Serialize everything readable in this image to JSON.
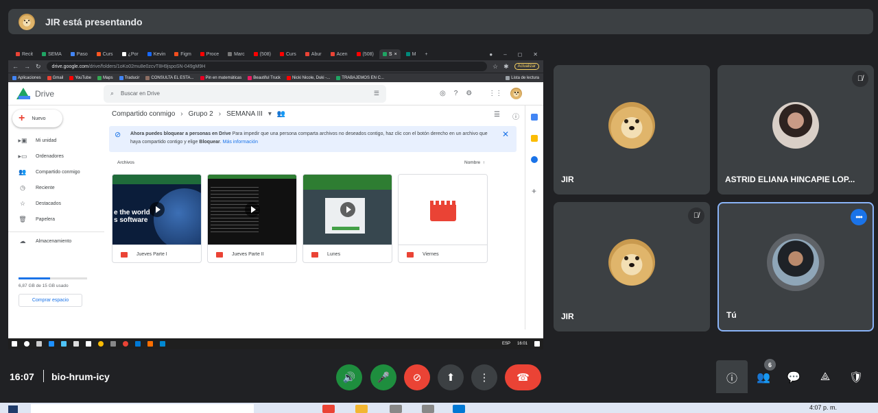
{
  "banner": {
    "text": "JIR está presentando",
    "avatar": "doge-avatar"
  },
  "shared_screen": {
    "browser": {
      "tabs": [
        "Recit",
        "SEMA",
        "Paso",
        "Curs",
        "¿Por",
        "Kevin",
        "Figm",
        "Proce",
        "Marc",
        "(508)",
        "Curs",
        "Abur",
        "Acen",
        "(508)",
        "S",
        "M"
      ],
      "url_domain": "drive.google.com",
      "url_path": "/drive/folders/1oKo02mu8e0zcvT8H9jspoSN-049gM9H",
      "update_label": "Actualizar",
      "bookmarks": [
        "Aplicaciones",
        "Gmail",
        "YouTube",
        "Maps",
        "Traducir",
        "CONSULTA EL ESTA...",
        "Pin en matemáticas",
        "Beautiful Truck",
        "Nicki Nicole, Duki -...",
        "TRABAJEMOS EN C..."
      ],
      "reading_list": "Lista de lectura"
    },
    "drive": {
      "app_name": "Drive",
      "search_placeholder": "Buscar en Drive",
      "new_label": "Nuevo",
      "nav": [
        "Mi unidad",
        "Ordenadores",
        "Compartido conmigo",
        "Reciente",
        "Destacados",
        "Papelera",
        "Almacenamiento"
      ],
      "storage_text": "6,87 GB de 15 GB usado",
      "storage_fraction": 0.458,
      "buy_label": "Comprar espacio",
      "breadcrumb": [
        "Compartido conmigo",
        "Grupo 2",
        "SEMANA III"
      ],
      "notice_bold": "Ahora puedes bloquear a personas en Drive",
      "notice_text": " Para impedir que una persona comparta archivos no deseados contigo, haz clic con el botón derecho en un archivo que haya compartido contigo y elige ",
      "notice_bold2": "Bloquear",
      "notice_link": "Más información",
      "section_label": "Archivos",
      "sort_label": "Nombre",
      "files": [
        {
          "name": "Jueves Parte I",
          "thumb_text": "e the world\ns software"
        },
        {
          "name": "Jueves Parte II"
        },
        {
          "name": "Lunes"
        },
        {
          "name": "Viernes"
        }
      ]
    },
    "taskbar": {
      "lang": "ESP",
      "time": "16:01"
    }
  },
  "participants": [
    {
      "name": "JIR",
      "muted": false
    },
    {
      "name": "ASTRID ELIANA HINCAPIE LOP...",
      "muted": true
    },
    {
      "name": "JIR",
      "muted": true
    },
    {
      "name": "Tú",
      "muted": false,
      "self": true
    }
  ],
  "meeting": {
    "time": "16:07",
    "code": "bio-hrum-icy",
    "participant_count": "6"
  },
  "colors": {
    "accent": "#1a73e8",
    "end_call": "#ea4335",
    "mic_on": "#1e8e3e",
    "tile_bg": "#3c4043"
  },
  "windows_taskbar": {
    "clock": "4:07 p. m."
  }
}
